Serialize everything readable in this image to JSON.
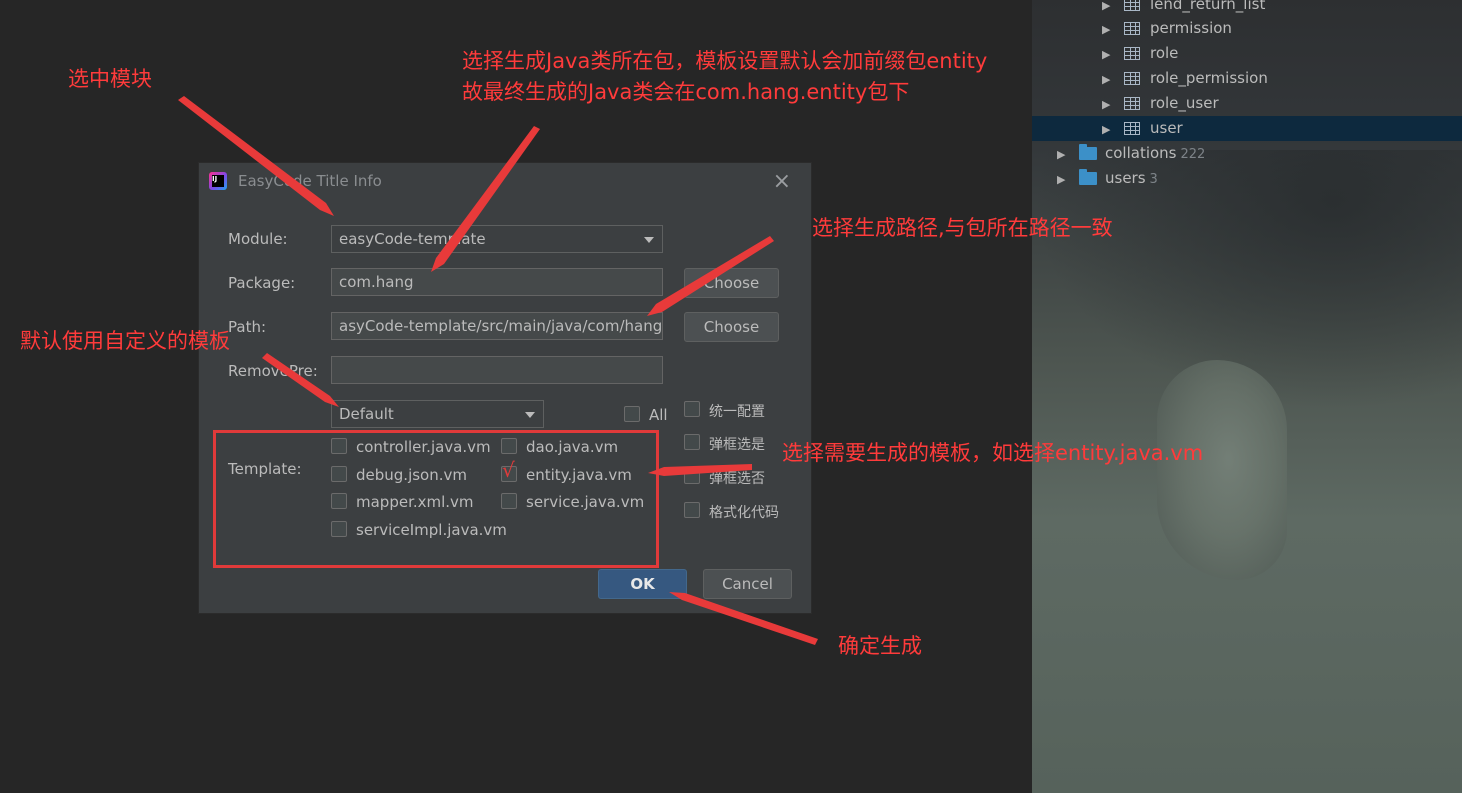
{
  "tree": {
    "items": [
      {
        "label": "lend_return_list",
        "kind": "table"
      },
      {
        "label": "permission",
        "kind": "table"
      },
      {
        "label": "role",
        "kind": "table"
      },
      {
        "label": "role_permission",
        "kind": "table"
      },
      {
        "label": "role_user",
        "kind": "table"
      },
      {
        "label": "user",
        "kind": "table",
        "selected": true
      },
      {
        "label": "collations",
        "count": "222",
        "kind": "folder"
      },
      {
        "label": "users",
        "count": "3",
        "kind": "folder"
      }
    ]
  },
  "dialog": {
    "title": "EasyCode Title Info",
    "module_label": "Module:",
    "module_value": "easyCode-template",
    "package_label": "Package:",
    "package_value": "com.hang",
    "path_label": "Path:",
    "path_value": "asyCode-template/src/main/java/com/hang",
    "removepre_label": "RemovePre:",
    "removepre_value": "",
    "choose_label": "Choose",
    "template_group_value": "Default",
    "all_label": "All",
    "side_options": [
      "统一配置",
      "弹框选是",
      "弹框选否",
      "格式化代码"
    ],
    "template_label": "Template:",
    "templates": [
      {
        "label": "controller.java.vm",
        "checked": false
      },
      {
        "label": "dao.java.vm",
        "checked": false
      },
      {
        "label": "debug.json.vm",
        "checked": false
      },
      {
        "label": "entity.java.vm",
        "checked": true
      },
      {
        "label": "mapper.xml.vm",
        "checked": false
      },
      {
        "label": "service.java.vm",
        "checked": false
      },
      {
        "label": "serviceImpl.java.vm",
        "checked": false
      }
    ],
    "ok_label": "OK",
    "cancel_label": "Cancel",
    "check_glyph": "√"
  },
  "annotations": {
    "select_module": "选中模块",
    "select_package_line1": "选择生成Java类所在包，模板设置默认会加前缀包entity",
    "select_package_line2": "故最终生成的Java类会在com.hang.entity包下",
    "select_path": "选择生成路径,与包所在路径一致",
    "default_template": "默认使用自定义的模板",
    "select_template": "选择需要生成的模板，如选择entity.java.vm",
    "confirm": "确定生成"
  },
  "colors": {
    "annotation_red": "#ff3b3b",
    "dialog_bg": "#3c3f41",
    "primary_button": "#365880",
    "selected_row": "#0d293e"
  }
}
